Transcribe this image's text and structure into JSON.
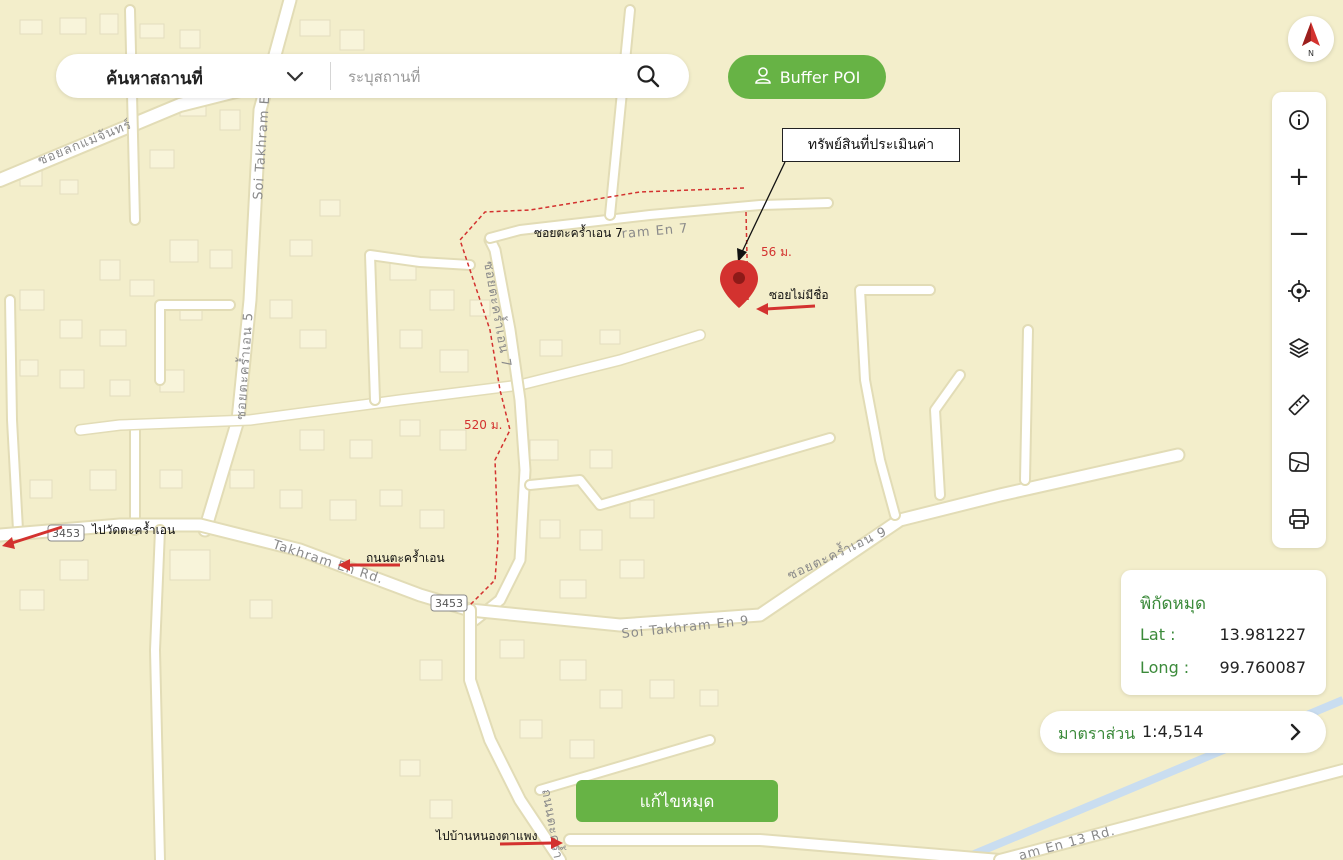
{
  "search": {
    "category_label": "ค้นหาสถานที่",
    "placeholder": "ระบุสถานที่"
  },
  "buffer_button": {
    "label": "Buffer POI"
  },
  "compass": {
    "north_label": "N"
  },
  "toolbar": {
    "tools": [
      "info-icon",
      "zoom-in-icon",
      "zoom-out-icon",
      "locate-icon",
      "layers-icon",
      "ruler-icon",
      "draw-area-icon",
      "print-icon"
    ],
    "zoom_in_label": "+",
    "zoom_out_label": "−"
  },
  "coordinates": {
    "title": "พิกัดหมุด",
    "lat_label": "Lat :",
    "lat_value": "13.981227",
    "long_label": "Long :",
    "long_value": "99.760087"
  },
  "scale": {
    "label": "มาตราส่วน",
    "value": "1:4,514"
  },
  "edit_pin_button": {
    "label": "แก้ไขหมุด"
  },
  "annotations": {
    "callout": "ทรัพย์สินที่ประเมินค่า",
    "soi_7": "ซอยตะคร้ำเอน 7",
    "unnamed_soi": "ซอยไม่มีชื่อ",
    "to_wat": "ไปวัดตะคร้ำเอน",
    "main_road": "ถนนตะคร้ำเอน",
    "to_ban": "ไปบ้านหนองตาแพง",
    "dist_56": "56 ม.",
    "dist_520": "520 ม."
  },
  "map_labels": {
    "soi_lok_mae_chan": "ซอยลกแม่จันทร์",
    "soi_takhram_5_en": "Soi Takhram En 5",
    "soi_takhram_5_th": "ซอยตะคร้ำเอน 5",
    "soi_takhram_7_en": "ram En 7",
    "soi_takhram_7_th": "ซอยตะคร้ำเอน 7",
    "takhram_rd": "Takhram En Rd.",
    "soi_takhram_9_en": "Soi Takhram En 9",
    "soi_takhram_9_th": "ซอยตะคร้ำเอน 9",
    "route_shield_1": "3453",
    "route_shield_2": "3453",
    "bottom_road_th": "ถนนตะคร้ำ",
    "en_13_rd": "am En 13 Rd."
  },
  "colors": {
    "map_background": "#f3eecb",
    "accent_green": "#67b345",
    "pin_red": "#d3322f",
    "water": "#c9ddf0"
  }
}
